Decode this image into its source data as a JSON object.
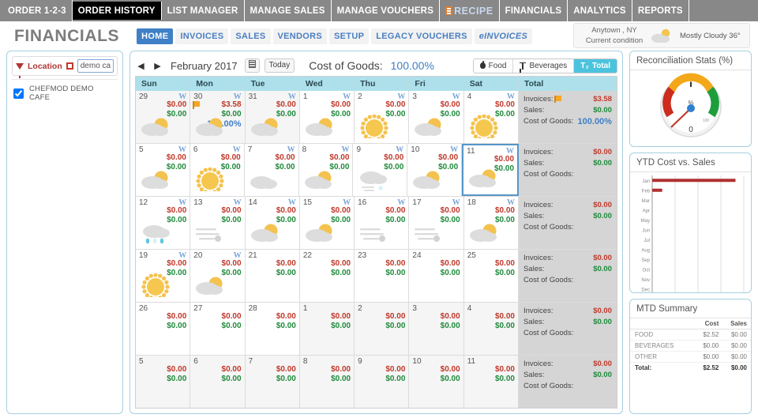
{
  "topnav": {
    "items": [
      {
        "label": "ORDER 1-2-3",
        "active": false
      },
      {
        "label": "ORDER HISTORY",
        "active": true
      },
      {
        "label": "LIST MANAGER",
        "active": false
      },
      {
        "label": "MANAGE SALES",
        "active": false
      },
      {
        "label": "MANAGE VOUCHERS",
        "active": false
      },
      {
        "label": "RECIPE",
        "active": false,
        "kind": "recipe"
      },
      {
        "label": "FINANCIALS",
        "active": false
      },
      {
        "label": "ANALYTICS",
        "active": false
      },
      {
        "label": "REPORTS",
        "active": false
      }
    ]
  },
  "header": {
    "title": "FINANCIALS",
    "subnav": [
      {
        "label": "HOME",
        "active": true
      },
      {
        "label": "INVOICES",
        "active": false
      },
      {
        "label": "SALES",
        "active": false
      },
      {
        "label": "VENDORS",
        "active": false
      },
      {
        "label": "SETUP",
        "active": false
      },
      {
        "label": "LEGACY VOUCHERS",
        "active": false
      },
      {
        "label": "eINVOICES",
        "active": false,
        "italic": true
      }
    ],
    "weather": {
      "location": "Anytown ,  NY",
      "caption": "Current condition",
      "condition": "Mostly Cloudy  36°",
      "icon": "partly-cloudy-icon"
    }
  },
  "location_panel": {
    "title": "Location",
    "filter_icon": "funnel-icon",
    "clear_icon": "red-square-icon",
    "search_value": "demo cafe",
    "search_placeholder": "demo cafe",
    "items": [
      {
        "label": "CHEFMOD DEMO CAFE",
        "checked": true
      }
    ]
  },
  "calendar": {
    "prev_label": "◀",
    "next_label": "▶",
    "month_label": "February 2017",
    "picker_label": "calendar-picker",
    "today_label": "Today",
    "cogs_label": "Cost of Goods:",
    "cogs_value": "100.00%",
    "segments": [
      {
        "label": "Food",
        "icon": "apple-icon",
        "active": false
      },
      {
        "label": "Beverages",
        "icon": "glass-icon",
        "active": false
      },
      {
        "label": "Total",
        "icon": "sigma-icon",
        "active": true
      }
    ],
    "day_headers": [
      "Sun",
      "Mon",
      "Tue",
      "Wed",
      "Thu",
      "Fri",
      "Sat",
      "Total"
    ],
    "total_labels": {
      "invoices": "Invoices:",
      "sales": "Sales:",
      "cogs": "Cost of Goods:"
    },
    "weeks": [
      {
        "days": [
          {
            "num": "29",
            "w": true,
            "red": "$0.00",
            "green": "$0.00",
            "pct": "",
            "wx": "partly-cloudy",
            "other": true,
            "flag": false,
            "today": false
          },
          {
            "num": "30",
            "w": true,
            "red": "$3.58",
            "green": "$0.00",
            "pct": "100.00%",
            "wx": "partly-cloudy",
            "other": true,
            "flag": true,
            "today": false
          },
          {
            "num": "31",
            "w": true,
            "red": "$0.00",
            "green": "$0.00",
            "pct": "",
            "wx": "partly-cloudy",
            "other": true,
            "flag": false,
            "today": false
          },
          {
            "num": "1",
            "w": true,
            "red": "$0.00",
            "green": "$0.00",
            "pct": "",
            "wx": "partly-cloudy",
            "other": false,
            "flag": false,
            "today": false
          },
          {
            "num": "2",
            "w": true,
            "red": "$0.00",
            "green": "$0.00",
            "pct": "",
            "wx": "sunny",
            "other": false,
            "flag": false,
            "today": false
          },
          {
            "num": "3",
            "w": true,
            "red": "$0.00",
            "green": "$0.00",
            "pct": "",
            "wx": "partly-cloudy",
            "other": false,
            "flag": false,
            "today": false
          },
          {
            "num": "4",
            "w": true,
            "red": "$0.00",
            "green": "$0.00",
            "pct": "",
            "wx": "sunny",
            "other": false,
            "flag": false,
            "today": false
          }
        ],
        "total": {
          "invoices": "$3.58",
          "sales": "$0.00",
          "cogs": "100.00%",
          "flag": true
        }
      },
      {
        "days": [
          {
            "num": "5",
            "w": true,
            "red": "$0.00",
            "green": "$0.00",
            "pct": "",
            "wx": "partly-cloudy",
            "other": false,
            "flag": false,
            "today": false
          },
          {
            "num": "6",
            "w": true,
            "red": "$0.00",
            "green": "$0.00",
            "pct": "",
            "wx": "sunny",
            "other": false,
            "flag": false,
            "today": false
          },
          {
            "num": "7",
            "w": true,
            "red": "$0.00",
            "green": "$0.00",
            "pct": "",
            "wx": "cloudy",
            "other": false,
            "flag": false,
            "today": false
          },
          {
            "num": "8",
            "w": true,
            "red": "$0.00",
            "green": "$0.00",
            "pct": "",
            "wx": "partly-cloudy",
            "other": false,
            "flag": false,
            "today": false
          },
          {
            "num": "9",
            "w": true,
            "red": "$0.00",
            "green": "$0.00",
            "pct": "",
            "wx": "snow",
            "other": false,
            "flag": false,
            "today": false
          },
          {
            "num": "10",
            "w": true,
            "red": "$0.00",
            "green": "$0.00",
            "pct": "",
            "wx": "partly-cloudy",
            "other": false,
            "flag": false,
            "today": false
          },
          {
            "num": "11",
            "w": true,
            "red": "$0.00",
            "green": "$0.00",
            "pct": "",
            "wx": "partly-cloudy",
            "other": false,
            "flag": false,
            "today": true
          }
        ],
        "total": {
          "invoices": "$0.00",
          "sales": "$0.00",
          "cogs": "",
          "flag": false
        }
      },
      {
        "days": [
          {
            "num": "12",
            "w": true,
            "red": "$0.00",
            "green": "$0.00",
            "pct": "",
            "wx": "rain",
            "other": false,
            "flag": false,
            "today": false
          },
          {
            "num": "13",
            "w": true,
            "red": "$0.00",
            "green": "$0.00",
            "pct": "",
            "wx": "wind",
            "other": false,
            "flag": false,
            "today": false
          },
          {
            "num": "14",
            "w": true,
            "red": "$0.00",
            "green": "$0.00",
            "pct": "",
            "wx": "partly-cloudy",
            "other": false,
            "flag": false,
            "today": false
          },
          {
            "num": "15",
            "w": true,
            "red": "$0.00",
            "green": "$0.00",
            "pct": "",
            "wx": "partly-cloudy",
            "other": false,
            "flag": false,
            "today": false
          },
          {
            "num": "16",
            "w": true,
            "red": "$0.00",
            "green": "$0.00",
            "pct": "",
            "wx": "wind",
            "other": false,
            "flag": false,
            "today": false
          },
          {
            "num": "17",
            "w": true,
            "red": "$0.00",
            "green": "$0.00",
            "pct": "",
            "wx": "wind",
            "other": false,
            "flag": false,
            "today": false
          },
          {
            "num": "18",
            "w": true,
            "red": "$0.00",
            "green": "$0.00",
            "pct": "",
            "wx": "partly-cloudy",
            "other": false,
            "flag": false,
            "today": false
          }
        ],
        "total": {
          "invoices": "$0.00",
          "sales": "$0.00",
          "cogs": "",
          "flag": false
        }
      },
      {
        "days": [
          {
            "num": "19",
            "w": true,
            "red": "$0.00",
            "green": "$0.00",
            "pct": "",
            "wx": "sunny",
            "other": false,
            "flag": false,
            "today": false
          },
          {
            "num": "20",
            "w": true,
            "red": "$0.00",
            "green": "$0.00",
            "pct": "",
            "wx": "partly-cloudy",
            "other": false,
            "flag": false,
            "today": false
          },
          {
            "num": "21",
            "w": false,
            "red": "$0.00",
            "green": "$0.00",
            "pct": "",
            "wx": "none",
            "other": false,
            "flag": false,
            "today": false
          },
          {
            "num": "22",
            "w": false,
            "red": "$0.00",
            "green": "$0.00",
            "pct": "",
            "wx": "none",
            "other": false,
            "flag": false,
            "today": false
          },
          {
            "num": "23",
            "w": false,
            "red": "$0.00",
            "green": "$0.00",
            "pct": "",
            "wx": "none",
            "other": false,
            "flag": false,
            "today": false
          },
          {
            "num": "24",
            "w": false,
            "red": "$0.00",
            "green": "$0.00",
            "pct": "",
            "wx": "none",
            "other": false,
            "flag": false,
            "today": false
          },
          {
            "num": "25",
            "w": false,
            "red": "$0.00",
            "green": "$0.00",
            "pct": "",
            "wx": "none",
            "other": false,
            "flag": false,
            "today": false
          }
        ],
        "total": {
          "invoices": "$0.00",
          "sales": "$0.00",
          "cogs": "",
          "flag": false
        }
      },
      {
        "days": [
          {
            "num": "26",
            "w": false,
            "red": "$0.00",
            "green": "$0.00",
            "pct": "",
            "wx": "none",
            "other": false,
            "flag": false,
            "today": false
          },
          {
            "num": "27",
            "w": false,
            "red": "$0.00",
            "green": "$0.00",
            "pct": "",
            "wx": "none",
            "other": false,
            "flag": false,
            "today": false
          },
          {
            "num": "28",
            "w": false,
            "red": "$0.00",
            "green": "$0.00",
            "pct": "",
            "wx": "none",
            "other": false,
            "flag": false,
            "today": false
          },
          {
            "num": "1",
            "w": false,
            "red": "$0.00",
            "green": "$0.00",
            "pct": "",
            "wx": "none",
            "other": true,
            "flag": false,
            "today": false
          },
          {
            "num": "2",
            "w": false,
            "red": "$0.00",
            "green": "$0.00",
            "pct": "",
            "wx": "none",
            "other": true,
            "flag": false,
            "today": false
          },
          {
            "num": "3",
            "w": false,
            "red": "$0.00",
            "green": "$0.00",
            "pct": "",
            "wx": "none",
            "other": true,
            "flag": false,
            "today": false
          },
          {
            "num": "4",
            "w": false,
            "red": "$0.00",
            "green": "$0.00",
            "pct": "",
            "wx": "none",
            "other": true,
            "flag": false,
            "today": false
          }
        ],
        "total": {
          "invoices": "$0.00",
          "sales": "$0.00",
          "cogs": "",
          "flag": false
        }
      },
      {
        "days": [
          {
            "num": "5",
            "w": false,
            "red": "$0.00",
            "green": "$0.00",
            "pct": "",
            "wx": "none",
            "other": true,
            "flag": false,
            "today": false
          },
          {
            "num": "6",
            "w": false,
            "red": "$0.00",
            "green": "$0.00",
            "pct": "",
            "wx": "none",
            "other": true,
            "flag": false,
            "today": false
          },
          {
            "num": "7",
            "w": false,
            "red": "$0.00",
            "green": "$0.00",
            "pct": "",
            "wx": "none",
            "other": true,
            "flag": false,
            "today": false
          },
          {
            "num": "8",
            "w": false,
            "red": "$0.00",
            "green": "$0.00",
            "pct": "",
            "wx": "none",
            "other": true,
            "flag": false,
            "today": false
          },
          {
            "num": "9",
            "w": false,
            "red": "$0.00",
            "green": "$0.00",
            "pct": "",
            "wx": "none",
            "other": true,
            "flag": false,
            "today": false
          },
          {
            "num": "10",
            "w": false,
            "red": "$0.00",
            "green": "$0.00",
            "pct": "",
            "wx": "none",
            "other": true,
            "flag": false,
            "today": false
          },
          {
            "num": "11",
            "w": false,
            "red": "$0.00",
            "green": "$0.00",
            "pct": "",
            "wx": "none",
            "other": true,
            "flag": false,
            "today": false
          }
        ],
        "total": {
          "invoices": "$0.00",
          "sales": "$0.00",
          "cogs": "",
          "flag": false
        }
      }
    ]
  },
  "widgets": {
    "gauge": {
      "title": "Reconciliation Stats (%)",
      "unit": "%",
      "value": "0",
      "max_label": "100",
      "colors": {
        "low": "#cc2b1d",
        "mid": "#f3a81a",
        "high": "#1d9e3c",
        "needle": "#c0392b",
        "hub": "#2f7fd1"
      }
    },
    "ytd": {
      "title": "YTD Cost vs. Sales",
      "months": [
        "Jan",
        "Feb",
        "Mar",
        "Apr",
        "May",
        "Jun",
        "Jul",
        "Aug",
        "Sep",
        "Oct",
        "Nov",
        "Dec"
      ],
      "bar_color": "#b03030"
    },
    "mtd": {
      "title": "MTD Summary",
      "columns": [
        "",
        "Cost",
        "Sales"
      ],
      "rows": [
        {
          "label": "FOOD",
          "cost": "$2.52",
          "sales": "$0.00"
        },
        {
          "label": "BEVERAGES",
          "cost": "$0.00",
          "sales": "$0.00"
        },
        {
          "label": "OTHER",
          "cost": "$0.00",
          "sales": "$0.00"
        }
      ],
      "total": {
        "label": "Total:",
        "cost": "$2.52",
        "sales": "$0.00"
      }
    }
  },
  "chart_data": [
    {
      "type": "bar",
      "title": "YTD Cost vs. Sales",
      "orientation": "horizontal",
      "categories": [
        "Jan",
        "Feb",
        "Mar",
        "Apr",
        "May",
        "Jun",
        "Jul",
        "Aug",
        "Sep",
        "Oct",
        "Nov",
        "Dec"
      ],
      "series": [
        {
          "name": "Cost",
          "values": [
            100,
            12,
            0,
            0,
            0,
            0,
            0,
            0,
            0,
            0,
            0,
            0
          ],
          "color": "#b03030"
        },
        {
          "name": "Sales",
          "values": [
            0,
            0,
            0,
            0,
            0,
            0,
            0,
            0,
            0,
            0,
            0,
            0
          ],
          "color": "#4a7fc1"
        }
      ],
      "xlabel": "",
      "ylabel": "",
      "grid": true,
      "legend": "none",
      "xlim": [
        0,
        110
      ]
    },
    {
      "type": "gauge",
      "title": "Reconciliation Stats (%)",
      "value": 0,
      "min": 0,
      "max": 100,
      "unit": "%",
      "bands": [
        {
          "from": 0,
          "to": 33,
          "color": "#cc2b1d"
        },
        {
          "from": 33,
          "to": 66,
          "color": "#f3a81a"
        },
        {
          "from": 66,
          "to": 100,
          "color": "#1d9e3c"
        }
      ]
    },
    {
      "type": "table",
      "title": "MTD Summary",
      "columns": [
        "",
        "Cost",
        "Sales"
      ],
      "rows": [
        [
          "FOOD",
          "$2.52",
          "$0.00"
        ],
        [
          "BEVERAGES",
          "$0.00",
          "$0.00"
        ],
        [
          "OTHER",
          "$0.00",
          "$0.00"
        ],
        [
          "Total:",
          "$2.52",
          "$0.00"
        ]
      ]
    }
  ]
}
